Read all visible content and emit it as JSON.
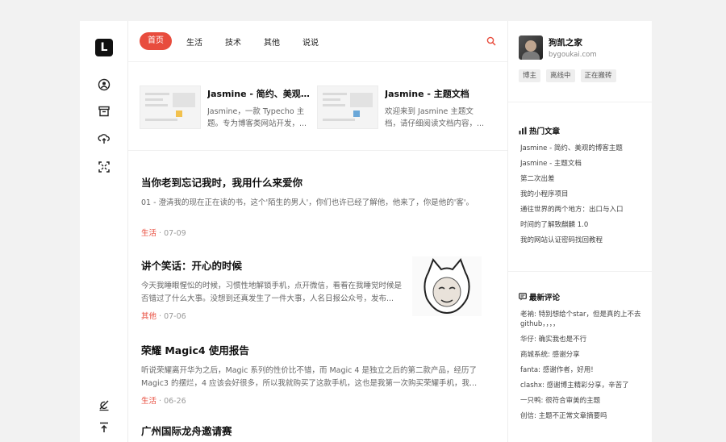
{
  "logo": {
    "letter": "L"
  },
  "nav": {
    "items": [
      "首页",
      "生活",
      "技术",
      "其他",
      "说说"
    ],
    "active": 0
  },
  "featured": [
    {
      "title": "Jasmine - 简约、美观的...",
      "desc": "Jasmine，一款 Typecho 主题。专为博客类网站开发，..."
    },
    {
      "title": "Jasmine - 主题文档",
      "desc": "欢迎来到 Jasmine 主题文档，请仔细阅读文档内容，..."
    }
  ],
  "posts": [
    {
      "title": "当你老到忘记我时，我用什么来爱你",
      "excerpt": "01 - 澄清我的现在正在读的书，这个'陌生的男人'，你们也许已经了解他，他来了，你是他的'客'。",
      "category": "生活",
      "date": "07-09"
    },
    {
      "title": "讲个笑话：开心的时候",
      "excerpt": "今天我睡眼惺忪的时候，习惯性地解锁手机，点开微信，看看在我睡觉时候是否错过了什么大事。没想到还真发生了一件大事，人名日报公众号，发布...",
      "category": "其他",
      "date": "07-06"
    },
    {
      "title": "荣耀 Magic4 使用报告",
      "excerpt": "听说荣耀离开华为之后，Magic 系列的性价比不错，而 Magic 4 是独立之后的第二款产品，经历了 Magic3 的摆烂，4 应该会好很多，所以我就购买了这款手机，这也是我第一次购买荣耀手机，我...",
      "category": "生活",
      "date": "06-26"
    },
    {
      "title": "广州国际龙舟邀请赛",
      "excerpt": "",
      "category": "",
      "date": ""
    }
  ],
  "sidebar": {
    "site_name": "狗凯之家",
    "site_url": "bygoukai.com",
    "tags": [
      "博主",
      "离线中",
      "正在搬砖"
    ],
    "hot_title": "热门文章",
    "hot": [
      "Jasmine - 简约、美观的博客主题",
      "Jasmine - 主题文档",
      "第二次出差",
      "我的小程序项目",
      "通往世界的两个地方：出口与入口",
      "时间的了解致麒麟 1.0",
      "我的网站认证密码找回教程"
    ],
    "comments_title": "最新评论",
    "comments": [
      "老衲: 特别想给个star，但是真的上不去github，，，，",
      "华仔: 确实我也是不行",
      "商城系统: 感谢分享",
      "fanta: 感谢作者，好用!",
      "clashx: 感谢博主精彩分享，辛苦了",
      "一只鸭: 很符合审美的主题",
      "创信: 主题不正常文章摘要吗"
    ]
  }
}
